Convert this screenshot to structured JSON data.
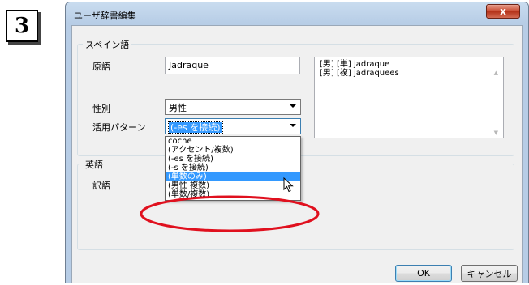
{
  "step_number": "3",
  "window": {
    "title": "ユーザ辞書編集",
    "close_symbol": "x"
  },
  "spanish_group": {
    "label": "スペイン語",
    "source_label": "原語",
    "source_value": "Jadraque",
    "preview_lines": [
      "[男] [単] jadraque",
      "[男] [複] jadraquees"
    ],
    "gender_label": "性別",
    "gender_value": "男性",
    "pattern_label": "活用パターン",
    "pattern_value": "(-es を接続)"
  },
  "dropdown": {
    "options": [
      "coche",
      "(アクセント/複数)",
      "(-es を接続)",
      "(-s を接続)",
      "(単数のみ)",
      "(男性 複数)",
      "(単数/複数)"
    ],
    "highlighted_index": 4
  },
  "english_group": {
    "label": "英語",
    "translation_label": "訳語"
  },
  "buttons": {
    "ok": "OK",
    "cancel": "キャンセル"
  },
  "colors": {
    "selection": "#3399ff",
    "annotation": "#e0101e",
    "close_button": "#c7452b"
  }
}
